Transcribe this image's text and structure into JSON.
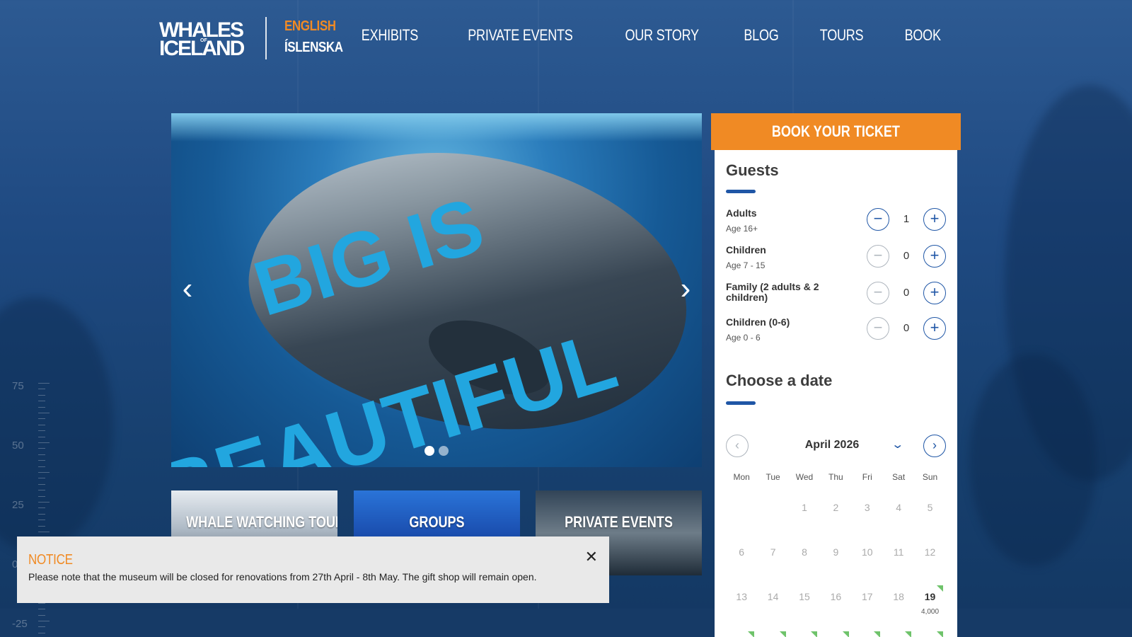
{
  "brand": {
    "logo_line1": "WHALES",
    "logo_of": "OF",
    "logo_line2": "ICELAND"
  },
  "languages": {
    "english": "ENGLISH",
    "icelandic": "ÍSLENSKA"
  },
  "nav": {
    "exhibits": "EXHIBITS",
    "private_events": "PRIVATE EVENTS",
    "our_story": "OUR STORY",
    "blog": "BLOG",
    "tours": "TOURS",
    "book": "BOOK"
  },
  "hero": {
    "line1": "BIG IS",
    "line2": "BEAUTIFUL",
    "prev_icon": "chevron-left-icon",
    "next_icon": "chevron-right-icon",
    "slides": 2,
    "active_slide": 1
  },
  "tiles": {
    "whale_watching": "WHALE WATCHING TOURS",
    "groups": "GROUPS",
    "private_events": "PRIVATE EVENTS"
  },
  "notice": {
    "title": "NOTICE",
    "text": "Please note that the museum will be closed for renovations from 27th April - 8th May. The gift shop will remain open.",
    "close_icon": "close-icon"
  },
  "depth_gauge": {
    "labels": [
      "75",
      "50",
      "25",
      "0",
      "-25"
    ]
  },
  "booking": {
    "header": "BOOK YOUR TICKET",
    "guests_title": "Guests",
    "guests": [
      {
        "name": "Adults",
        "sub": "Age 16+",
        "value": "1"
      },
      {
        "name": "Children",
        "sub": "Age 7 - 15",
        "value": "0"
      },
      {
        "name": "Family (2 adults & 2 children)",
        "sub": "",
        "value": "0"
      },
      {
        "name": "Children (0-6)",
        "sub": "Age 0 - 6",
        "value": "0"
      }
    ],
    "date_title": "Choose a date",
    "month": "April 2026",
    "weekdays": [
      "Mon",
      "Tue",
      "Wed",
      "Thu",
      "Fri",
      "Sat",
      "Sun"
    ],
    "weeks": [
      [
        "",
        "",
        "1",
        "2",
        "3",
        "4",
        "5"
      ],
      [
        "6",
        "7",
        "8",
        "9",
        "10",
        "11",
        "12"
      ],
      [
        "13",
        "14",
        "15",
        "16",
        "17",
        "18",
        "19"
      ]
    ],
    "available_day": "19",
    "available_price": "4,000",
    "colors": {
      "accent": "#f08a24",
      "primary": "#1f56a6",
      "available": "#6fc36b"
    }
  }
}
